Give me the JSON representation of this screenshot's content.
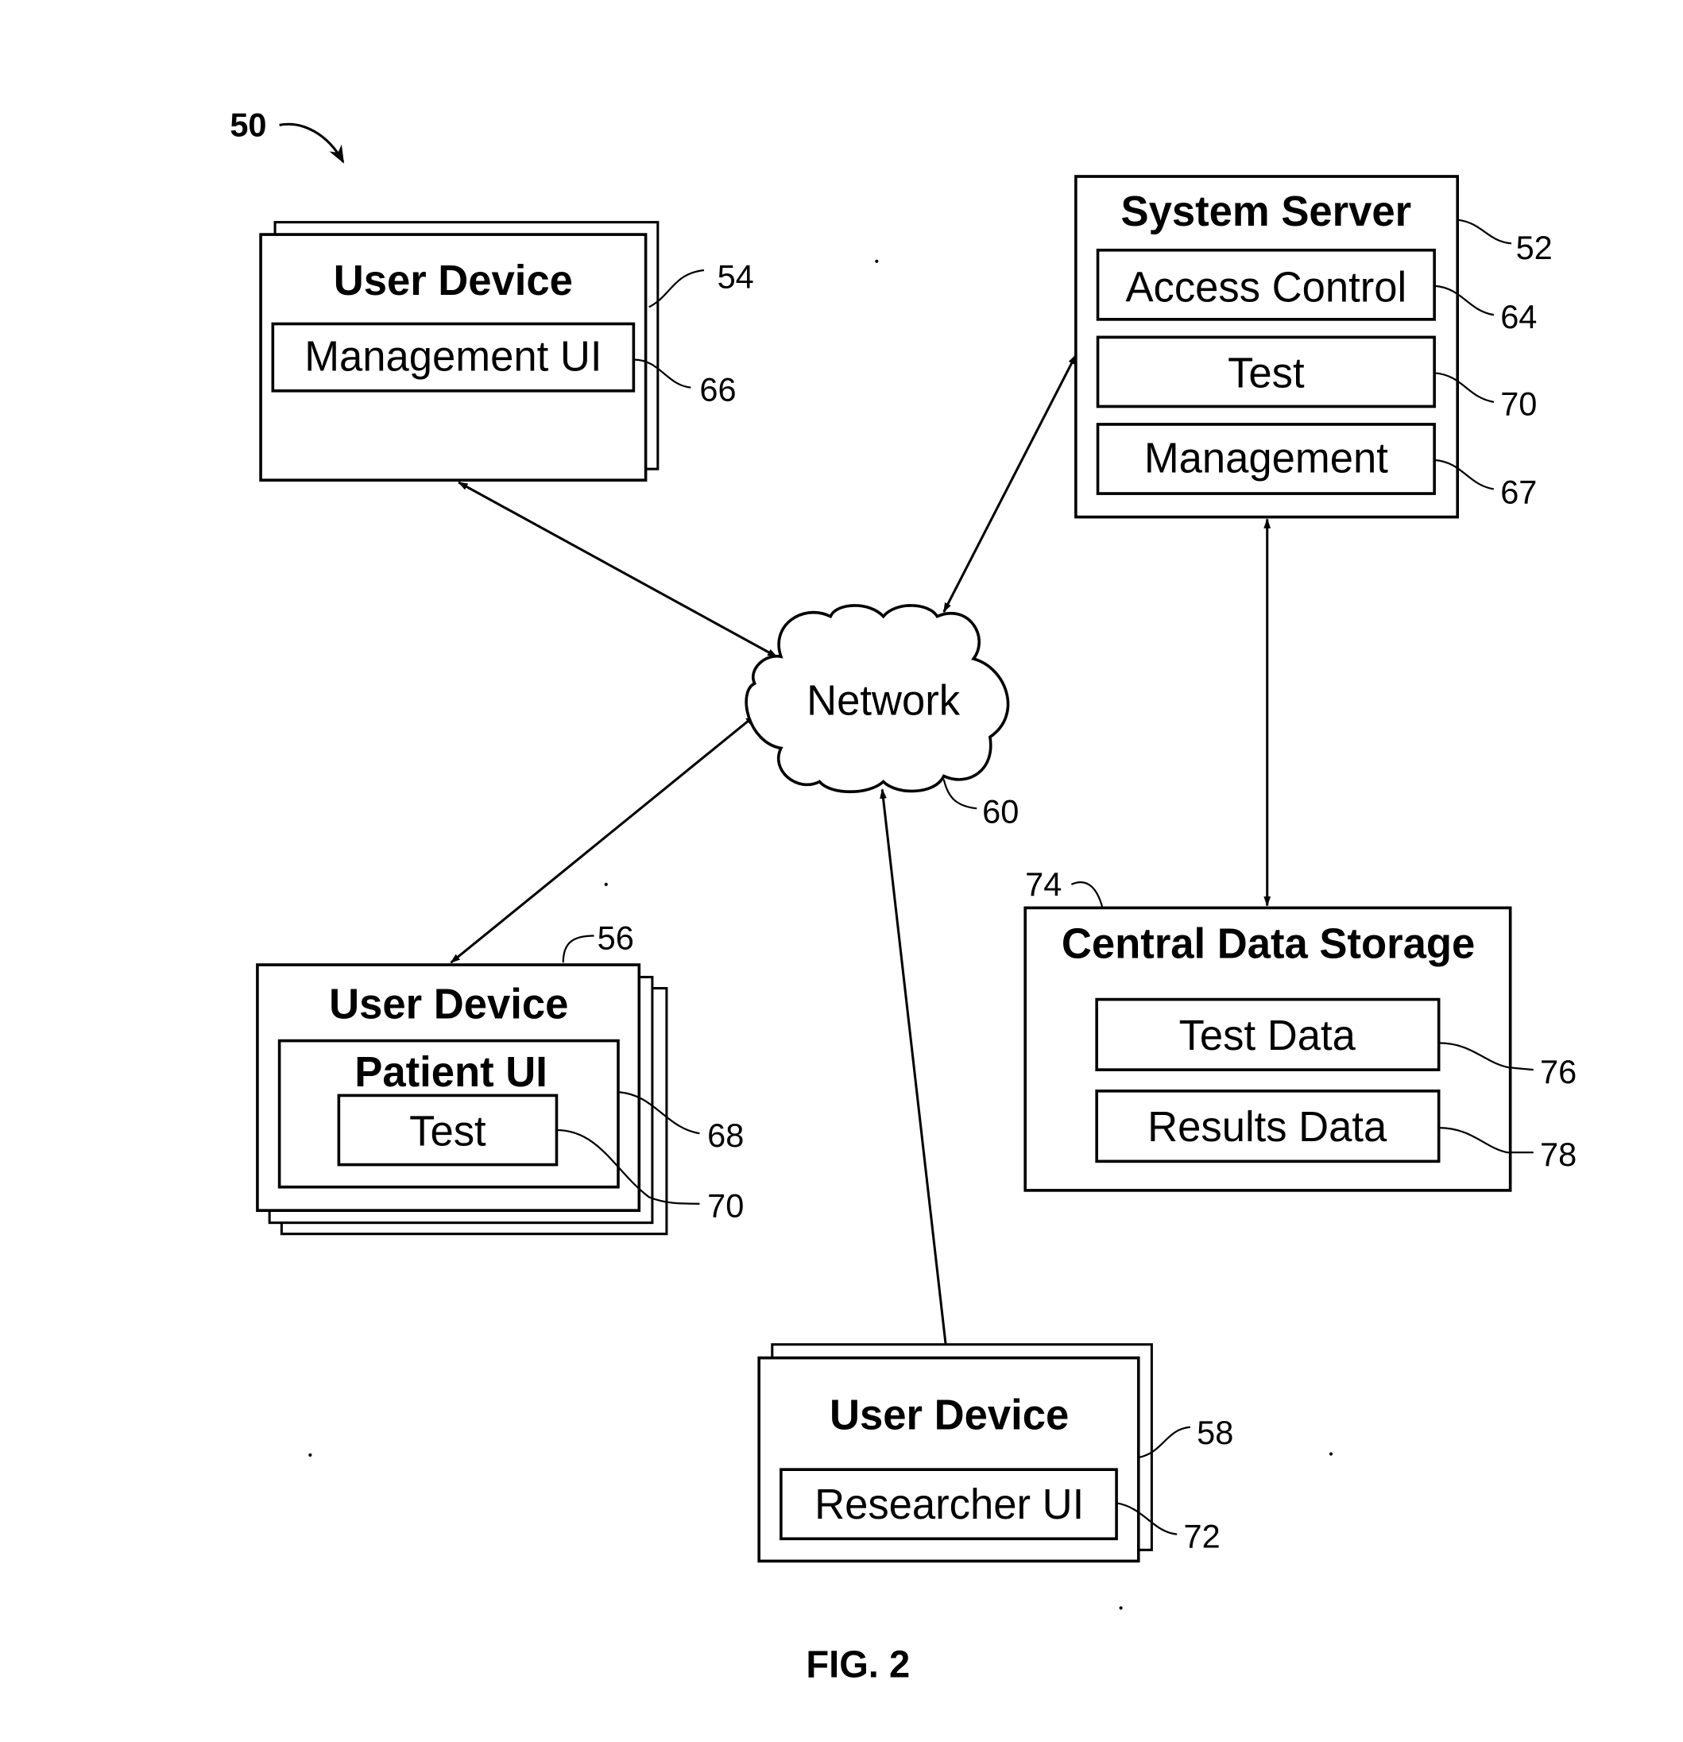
{
  "figure": {
    "caption": "FIG. 2",
    "system_ref": "50"
  },
  "nodes": {
    "management_device": {
      "title": "User Device",
      "ref": "54",
      "components": [
        {
          "label": "Management UI",
          "ref": "66"
        }
      ]
    },
    "system_server": {
      "title": "System Server",
      "ref": "52",
      "components": [
        {
          "label": "Access Control",
          "ref": "64"
        },
        {
          "label": "Test",
          "ref": "70"
        },
        {
          "label": "Management",
          "ref": "67"
        }
      ]
    },
    "network": {
      "title": "Network",
      "ref": "60"
    },
    "central_data_storage": {
      "title": "Central Data Storage",
      "ref": "74",
      "components": [
        {
          "label": "Test Data",
          "ref": "76"
        },
        {
          "label": "Results Data",
          "ref": "78"
        }
      ]
    },
    "patient_device": {
      "title": "User Device",
      "ref": "56",
      "ui": {
        "label": "Patient UI",
        "ref": "68"
      },
      "components": [
        {
          "label": "Test",
          "ref": "70"
        }
      ]
    },
    "researcher_device": {
      "title": "User Device",
      "ref": "58",
      "components": [
        {
          "label": "Researcher UI",
          "ref": "72"
        }
      ]
    }
  },
  "connections": [
    {
      "from": "management_device",
      "to": "network",
      "bidirectional": true
    },
    {
      "from": "patient_device",
      "to": "network",
      "bidirectional": true
    },
    {
      "from": "researcher_device",
      "to": "network",
      "bidirectional": true
    },
    {
      "from": "system_server",
      "to": "network",
      "bidirectional": true
    },
    {
      "from": "system_server",
      "to": "central_data_storage",
      "bidirectional": true
    }
  ]
}
